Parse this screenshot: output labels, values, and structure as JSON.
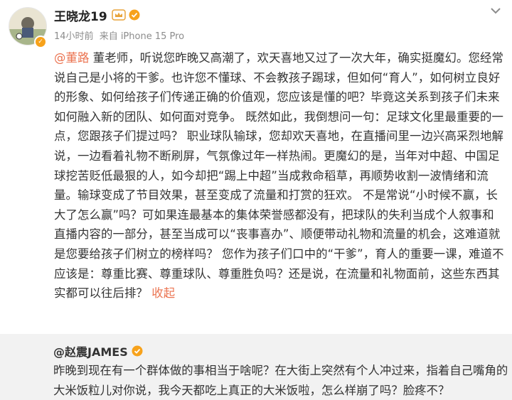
{
  "post": {
    "author": "王晓龙19",
    "meta": {
      "time": "14小时前",
      "source": "来自 iPhone 15 Pro"
    },
    "mention": "@董路",
    "paragraph": " 董老师，听说您昨晚又高潮了，欢天喜地又过了一次大年，确实挺魔幻。您经常说自己是小将的干爹。也许您不懂球、不会教孩子踢球，但如何“育人”，如何树立良好的形象、如何给孩子们传递正确的价值观，您应该是懂的吧？毕竟这关系到孩子们未来如何融入新的团队、如何面对竞争。 既然如此，我倒想问一句：足球文化里最重要的一点，您跟孩子们提过吗？ 职业球队输球，您却欢天喜地，在直播间里一边兴高采烈地解说，一边看着礼物不断刷屏，气氛像过年一样热闹。更魔幻的是，当年对中超、中国足球挖苦贬低最狠的人，如今却把“踢上中超”当成救命稻草，再顺势收割一波情绪和流量。输球变成了节目效果，甚至变成了流量和打赏的狂欢。 不是常说“小时候不赢，长大了怎么赢”吗？可如果连最基本的集体荣誉感都没有，把球队的失利当成个人叙事和直播内容的一部分，甚至当成可以“丧事喜办”、顺便带动礼物和流量的机会，这难道就是您要给孩子们树立的榜样吗？ 您作为孩子们口中的“干爹”，育人的重要一课，难道不应该是：尊重比赛、尊重球队、尊重胜负吗？还是说，在流量和礼物面前，这些东西其实都可以往后排？",
    "collapse_label": "收起"
  },
  "retweet": {
    "author": "@赵震JAMES",
    "text": "昨晚到现在有一个群体做的事相当于啥呢？在大街上突然有个人冲过来，指着自己嘴角的大米饭粒儿对你说，我今天都吃上真正的大米饭啦，怎么样崩了吗？脸疼不？"
  },
  "icons": {
    "crown": "crown-icon",
    "vip": "vip-icon",
    "verified": "verified-badge-icon",
    "chevron": "chevron-down-icon"
  },
  "colors": {
    "link": "#eb7350",
    "badge": "#f7a21b",
    "retweet_bg": "#f2f2f2"
  }
}
